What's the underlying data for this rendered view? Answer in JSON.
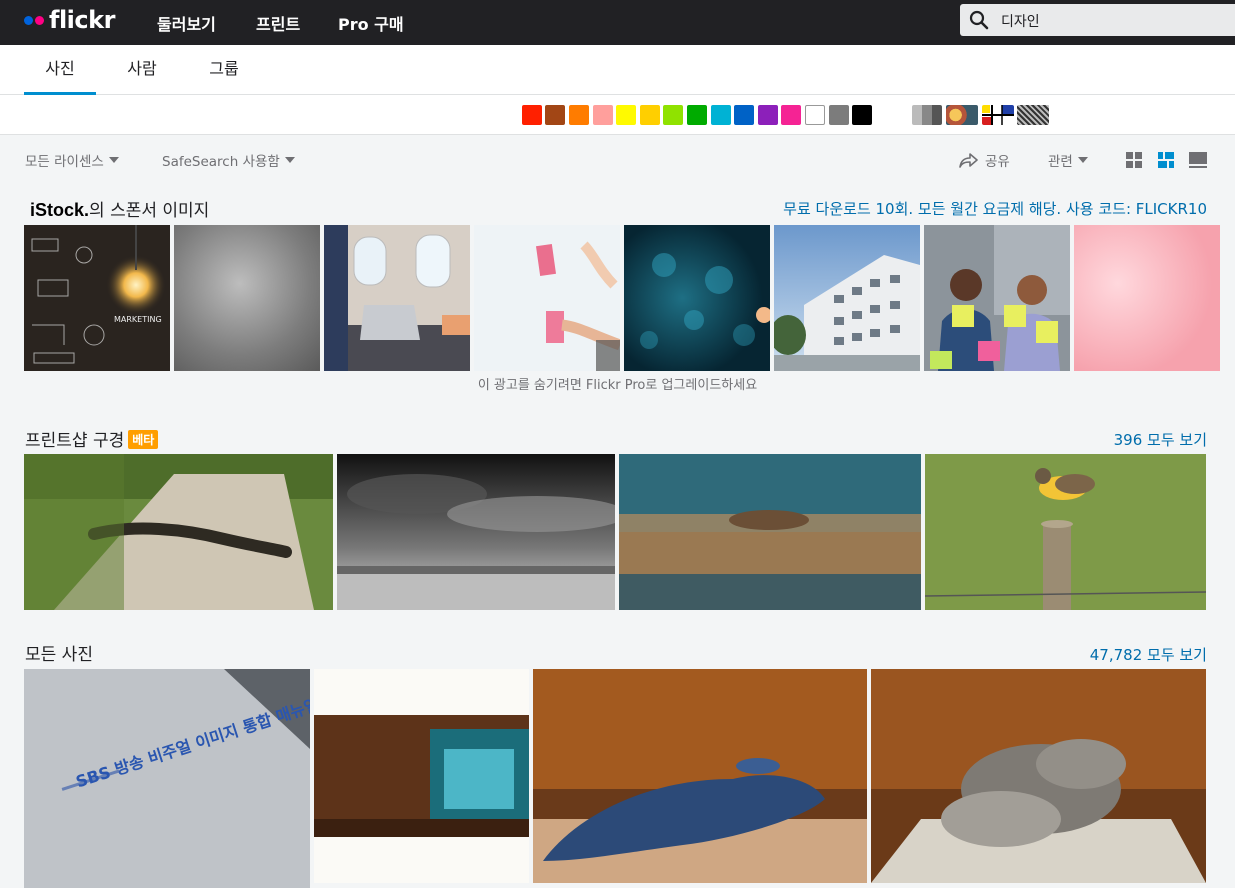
{
  "header": {
    "logo_text": "flickr",
    "nav": [
      "둘러보기",
      "프린트",
      "Pro 구매"
    ],
    "search_value": "디자인",
    "search_icon": "search-icon"
  },
  "tabs": [
    {
      "label": "사진",
      "active": true
    },
    {
      "label": "사람",
      "active": false
    },
    {
      "label": "그룹",
      "active": false
    }
  ],
  "color_filters": [
    "#ff2000",
    "#a24615",
    "#ff7c00",
    "#ff9f9c",
    "#fffa00",
    "#ffcf00",
    "#90e200",
    "#00ab00",
    "#00b2d4",
    "#0062c6",
    "#8c20ba",
    "#f52394",
    "#ffffff",
    "#7c7c7c",
    "#000000"
  ],
  "style_filters": [
    "black-and-white-filter-icon",
    "shallow-depth-of-field-filter-icon",
    "minimalism-filter-icon",
    "patterns-filter-icon"
  ],
  "filters": {
    "license": "모든 라이센스",
    "safesearch": "SafeSearch 사용함",
    "share": "공유",
    "sort": "관련"
  },
  "view_icons": [
    "grid-small-icon",
    "justified-icon",
    "large-view-icon"
  ],
  "sponsor": {
    "brand": "iStock.",
    "title_suffix": "의 스폰서 이미지",
    "promo": "무료 다운로드 10회. 모든 월간 요금제 해당. 사용 코드: FLICKR10",
    "upgrade_note": "이 광고를 숨기려면 Flickr Pro로 업그레이드하세요"
  },
  "printshop": {
    "title": "프린트샵 구경",
    "badge": "베타",
    "link": "396 모두 보기"
  },
  "all_photos": {
    "title": "모든 사진",
    "link": "47,782 모두 보기",
    "photo1_caption": "SBS 방송 비주얼 이미지 통합 매뉴얼"
  }
}
